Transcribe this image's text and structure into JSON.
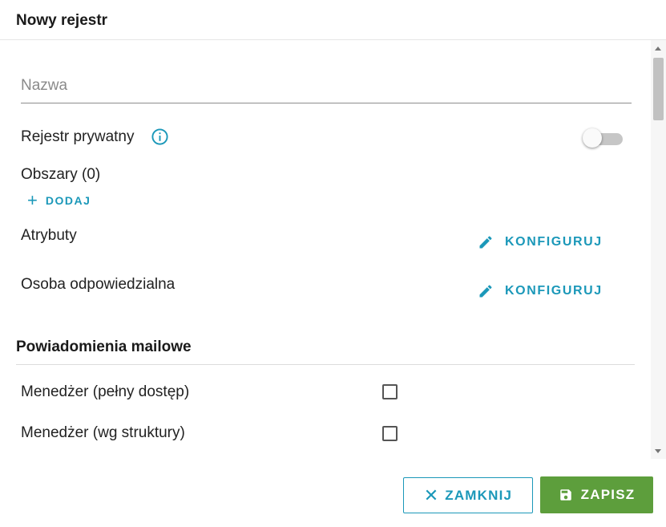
{
  "dialog": {
    "title": "Nowy rejestr"
  },
  "form": {
    "name_placeholder": "Nazwa",
    "private_label": "Rejestr prywatny",
    "areas_label": "Obszary (0)",
    "add_label": "DODAJ",
    "add_icon": "+",
    "attributes_label": "Atrybuty",
    "responsible_label": "Osoba odpowiedzialna",
    "configure_label": "KONFIGURUJ"
  },
  "notifications": {
    "title": "Powiadomienia mailowe",
    "items": [
      {
        "label": "Menedżer (pełny dostęp)"
      },
      {
        "label": "Menedżer (wg struktury)"
      }
    ]
  },
  "footer": {
    "close_label": "ZAMKNIJ",
    "close_icon": "✕",
    "save_label": "ZAPISZ"
  },
  "colors": {
    "accent": "#1b98b9",
    "save": "#5d9e3c"
  }
}
